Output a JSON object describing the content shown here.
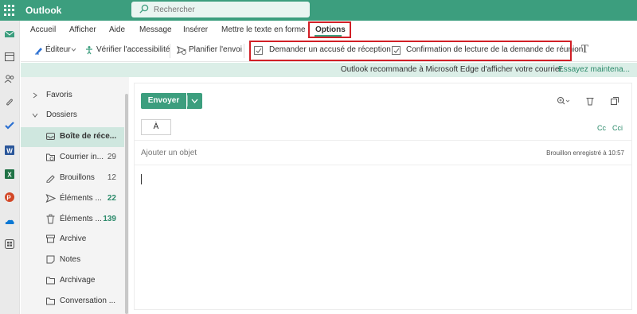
{
  "app": {
    "name": "Outlook"
  },
  "search": {
    "placeholder": "Rechercher"
  },
  "tabs": [
    "Accueil",
    "Afficher",
    "Aide",
    "Message",
    "Insérer",
    "Mettre le texte en forme",
    "Options"
  ],
  "active_tab": "Options",
  "ribbon": {
    "editor": "Éditeur",
    "accessibility": "Vérifier l'accessibilité",
    "schedule": "Planifier l'envoi",
    "read_receipt": "Demander un accusé de réception",
    "meeting_read": "Confirmation de lecture de la demande de réunion",
    "text_icon": "T"
  },
  "infobar": {
    "message": "Outlook recommande à Microsoft Edge d'afficher votre courrier.",
    "link": "Essayez maintena..."
  },
  "folders": {
    "favorites": "Favoris",
    "folders": "Dossiers",
    "items": [
      {
        "label": "Boîte de réce...",
        "count": "",
        "icon": "inbox-icon"
      },
      {
        "label": "Courrier in...",
        "count": "29",
        "icon": "junk-mail-icon"
      },
      {
        "label": "Brouillons",
        "count": "12",
        "icon": "drafts-icon"
      },
      {
        "label": "Éléments ...",
        "count": "22",
        "icon": "sent-icon"
      },
      {
        "label": "Éléments ...",
        "count": "139",
        "icon": "trash-icon"
      },
      {
        "label": "Archive",
        "count": "",
        "icon": "archive-icon"
      },
      {
        "label": "Notes",
        "count": "",
        "icon": "notes-icon"
      },
      {
        "label": "Archivage",
        "count": "",
        "icon": "folder-icon"
      },
      {
        "label": "Conversation ...",
        "count": "",
        "icon": "folder-icon"
      }
    ]
  },
  "compose": {
    "send": "Envoyer",
    "to": "À",
    "cc": "Cc",
    "bcc": "Cci",
    "subject_placeholder": "Ajouter un objet",
    "draft_status": "Brouillon enregistré à 10:57"
  },
  "colors": {
    "brand": "#3c9e7e",
    "highlight": "#d11f26",
    "selected": "#cfe7df"
  }
}
